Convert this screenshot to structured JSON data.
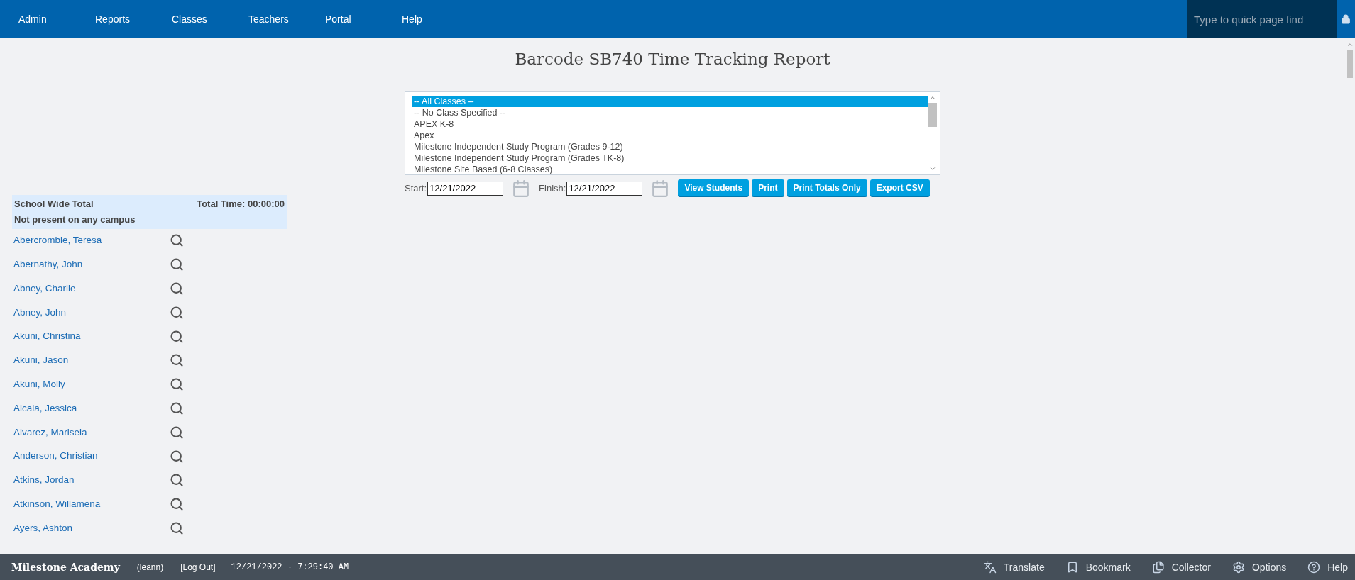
{
  "nav": {
    "items": [
      "Admin",
      "Reports",
      "Classes",
      "Teachers",
      "Portal",
      "Help"
    ],
    "search": {
      "placeholder": "Type to quick page find"
    }
  },
  "title": "Barcode SB740 Time Tracking Report",
  "class_list": [
    {
      "label": "-- All Classes --",
      "selected": true
    },
    {
      "label": "-- No Class Specified --",
      "selected": false
    },
    {
      "label": "APEX K-8",
      "selected": false
    },
    {
      "label": "Apex",
      "selected": false
    },
    {
      "label": "Milestone Independent Study Program (Grades 9-12)",
      "selected": false
    },
    {
      "label": "Milestone Independent Study Program (Grades TK-8)",
      "selected": false
    },
    {
      "label": "Milestone Site Based (6-8 Classes)",
      "selected": false
    }
  ],
  "start": {
    "label": "Start:",
    "value": "12/21/2022"
  },
  "finish": {
    "label": "Finish:",
    "value": "12/21/2022"
  },
  "buttons": [
    "View Students",
    "Print",
    "Print Totals Only",
    "Export CSV"
  ],
  "summary": {
    "label": "School Wide Total",
    "total": "Total Time: 00:00:00",
    "note": "Not present on any campus"
  },
  "students": [
    "Abercrombie, Teresa",
    "Abernathy, John",
    "Abney, Charlie",
    "Abney, John",
    "Akuni, Christina",
    "Akuni, Jason",
    "Akuni, Molly",
    "Alcala, Jessica",
    "Alvarez, Marisela",
    "Anderson, Christian",
    "Atkins, Jordan",
    "Atkinson, Willamena",
    "Ayers, Ashton"
  ],
  "footer": {
    "school": "Milestone Academy",
    "user": "(leann)",
    "logout": "[Log Out]",
    "datetime": "12/21/2022 - 7:29:40 AM",
    "tools": [
      {
        "kind": "translate",
        "label": "Translate"
      },
      {
        "kind": "bookmark",
        "label": "Bookmark"
      },
      {
        "kind": "collector",
        "label": "Collector"
      },
      {
        "kind": "options",
        "label": "Options"
      },
      {
        "kind": "help",
        "label": "Help"
      }
    ]
  }
}
